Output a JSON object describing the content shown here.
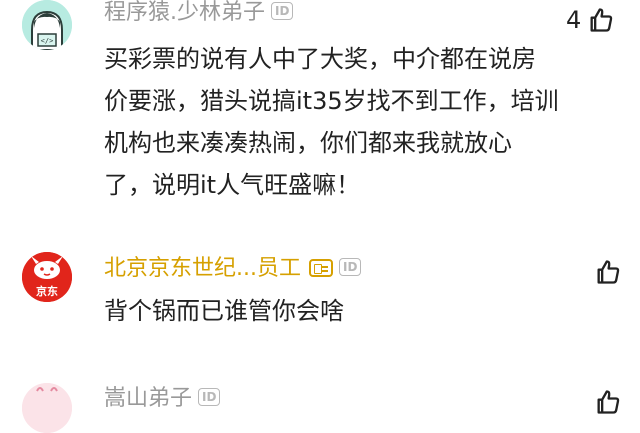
{
  "comments": [
    {
      "username": "程序猿.少林弟子",
      "badge": "ID",
      "lines": [
        "买彩票的说有人中了大奖，中介都在说房",
        "价要涨，猎头说搞it35岁找不到工作，培训",
        "机构也来凑凑热闹，你们都来我就放心",
        "了，说明it人气旺盛嘛！"
      ],
      "likes": "4",
      "like_icon": "thumbs-up-icon"
    },
    {
      "username": "北京京东世纪...员工",
      "badge": "ID",
      "avatar_text": "京东",
      "verify_icon": "verified-employee-icon",
      "lines": [
        "背个锅而已谁管你会啥"
      ],
      "likes": "",
      "like_icon": "thumbs-up-icon"
    },
    {
      "username": "嵩山弟子",
      "badge": "ID",
      "lines": [],
      "likes": "",
      "like_icon": "thumbs-up-icon"
    }
  ],
  "colors": {
    "username_gray": "#999999",
    "username_gold": "#d6a000",
    "jd_red": "#e1251b",
    "text": "#222222"
  }
}
